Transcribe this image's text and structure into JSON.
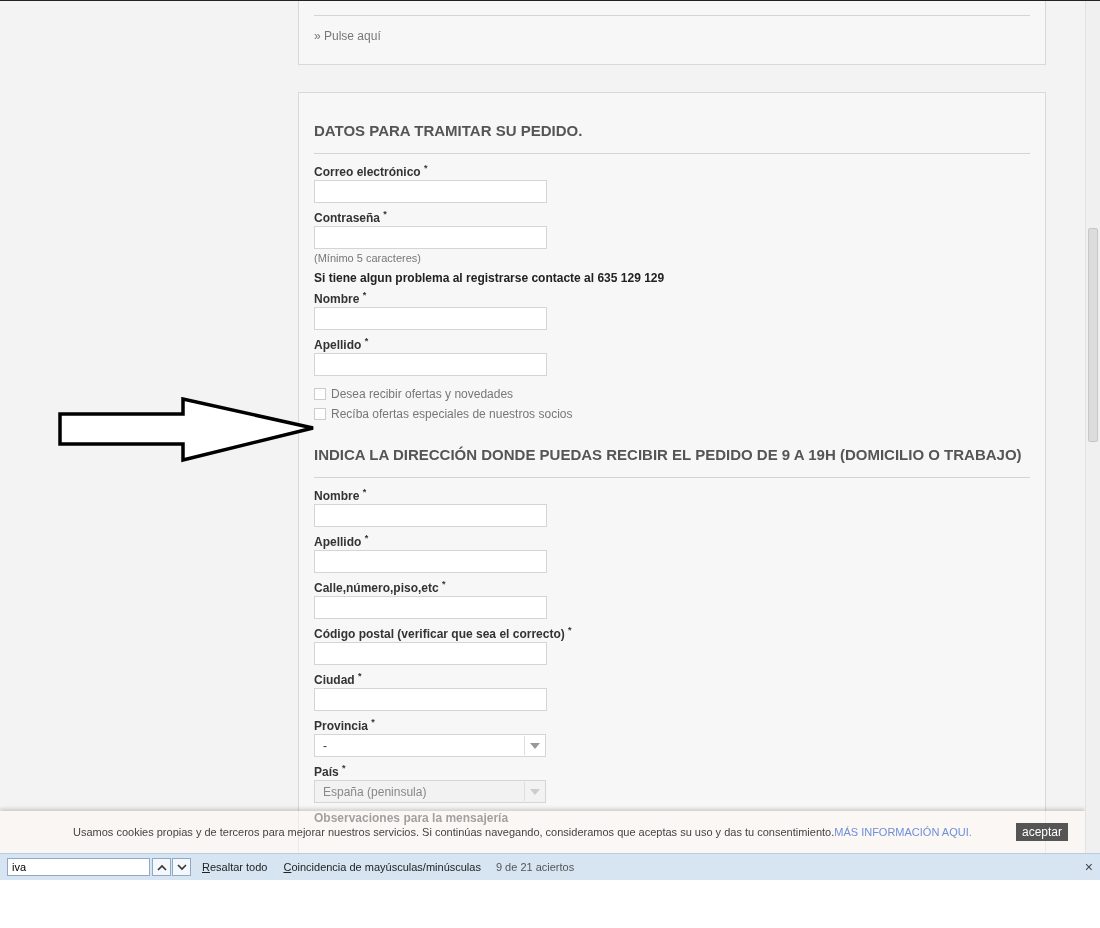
{
  "top_panel": {
    "link": "» Pulse aquí"
  },
  "sections": [
    {
      "title": "DATOS PARA TRAMITAR SU PEDIDO.",
      "items": [
        {
          "kind": "field",
          "label": "Correo electrónico $^{*}$"
        },
        {
          "kind": "field",
          "label": "Contraseña $^{*}$"
        },
        {
          "kind": "hint",
          "text": "(Mínimo 5 caracteres)"
        },
        {
          "kind": "notice",
          "text": "Si tiene algun problema al registrarse contacte al 635 129 129"
        },
        {
          "kind": "field",
          "label": "Nombre $^{*}$"
        },
        {
          "kind": "field",
          "label": "Apellido $^{*}$"
        },
        {
          "kind": "checkbox",
          "label": "Desea recibir ofertas y novedades",
          "checked": false
        },
        {
          "kind": "checkbox",
          "label": "Recíba ofertas especiales de nuestros socios",
          "checked": false
        }
      ]
    },
    {
      "title": "INDICA LA DIRECCIÓN DONDE PUEDAS RECIBIR EL PEDIDO DE 9 A 19H (DOMICILIO O TRABAJO)",
      "items": [
        {
          "kind": "field",
          "label": "Nombre $^{*}$"
        },
        {
          "kind": "field",
          "label": "Apellido $^{*}$"
        },
        {
          "kind": "field",
          "label": "Calle,número,piso,etc $^{*}$"
        },
        {
          "kind": "field",
          "label": "Código postal (verificar que sea el correcto) $^{*}$"
        },
        {
          "kind": "field",
          "label": "Ciudad $^{*}$"
        },
        {
          "kind": "select",
          "label": "Provincia $^{*}$",
          "value": "-",
          "disabled": false
        },
        {
          "kind": "select",
          "label": "País $^{*}$",
          "value": "España (peninsula)",
          "disabled": true
        },
        {
          "kind": "label",
          "label": "Observaciones para la mensajería"
        }
      ]
    }
  ],
  "cookie_banner": {
    "text": "Usamos cookies propias y de terceros para mejorar nuestros servicios. Si continúas navegando, consideramos que aceptas su uso y das tu consentimiento.",
    "link": "MÁS INFORMACIÓN AQUI.",
    "button": "aceptar"
  },
  "find_bar": {
    "query": "iva",
    "highlight_all": "Resaltar todo",
    "match_case": "Coincidencia de mayúsculas/minúsculas",
    "result": "9 de 21 aciertos",
    "close": "×"
  }
}
